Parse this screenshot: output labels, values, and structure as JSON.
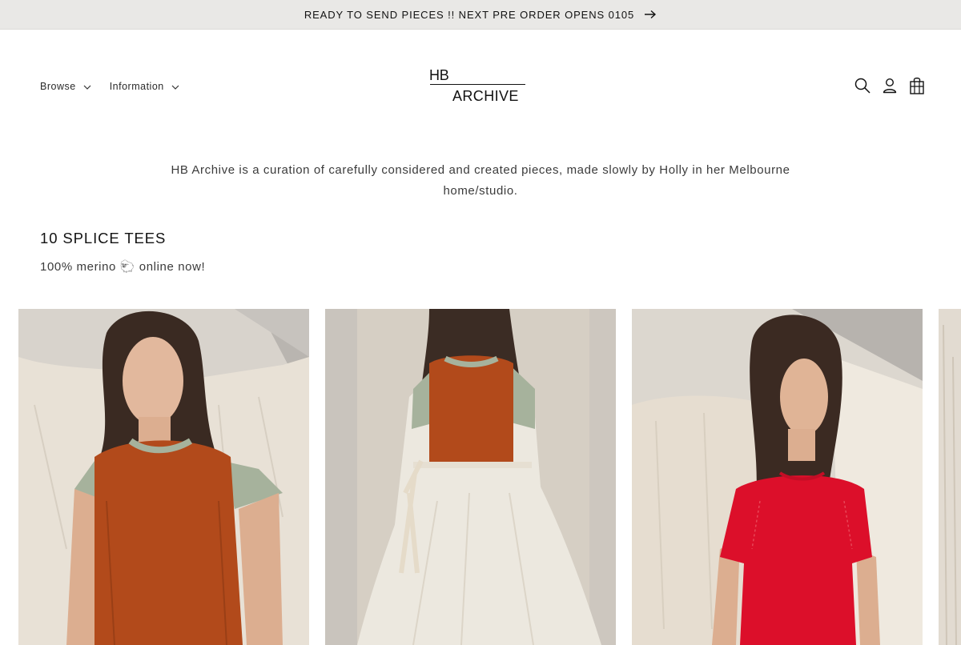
{
  "announcement": {
    "text": "READY TO SEND PIECES !! NEXT PRE ORDER OPENS 0105",
    "arrow_icon": "arrow-right-icon"
  },
  "header": {
    "nav": [
      {
        "label": "Browse",
        "icon": "chevron-down-icon"
      },
      {
        "label": "Information",
        "icon": "chevron-down-icon"
      }
    ],
    "logo": {
      "line1": "HB",
      "line2": "ARCHIVE"
    },
    "icons": [
      "search-icon",
      "account-icon",
      "cart-icon"
    ]
  },
  "intro": {
    "text": "HB Archive is a curation of carefully considered and created pieces, made slowly by Holly in her Melbourne home/studio."
  },
  "collection": {
    "title": "10 SPLICE TEES",
    "subtitle": "100% merino 🐑 online now!"
  },
  "products": [
    {
      "description": "rust merino splice tee with sage sleeves"
    },
    {
      "description": "rust splice tee layered over long sleeve with white wrap skirt"
    },
    {
      "description": "red merino splice tee"
    },
    {
      "description": "partial product image"
    }
  ],
  "colors": {
    "announcement_bg": "#e9e8e6",
    "text": "#121212",
    "muted_text": "#3b3b3b",
    "rust": "#b24a1b",
    "sage": "#a6b29c",
    "red": "#dc0f2a"
  }
}
